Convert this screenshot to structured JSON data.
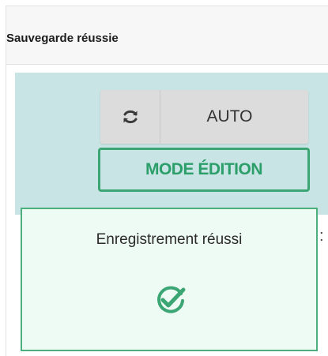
{
  "dialog": {
    "title": "Sauvegarde réussie"
  },
  "toolbar": {
    "refresh_icon": "refresh-icon",
    "auto_label": "AUTO",
    "mode_label": "MODE ÉDITION",
    "background_color": "#c9e4e4",
    "accent_color": "#3ba673"
  },
  "notification": {
    "message": "Enregistrement réussi",
    "icon": "check-circle-icon",
    "background_color": "#eefaf4",
    "accent_color": "#4bb07e"
  },
  "clipped_text": ":"
}
